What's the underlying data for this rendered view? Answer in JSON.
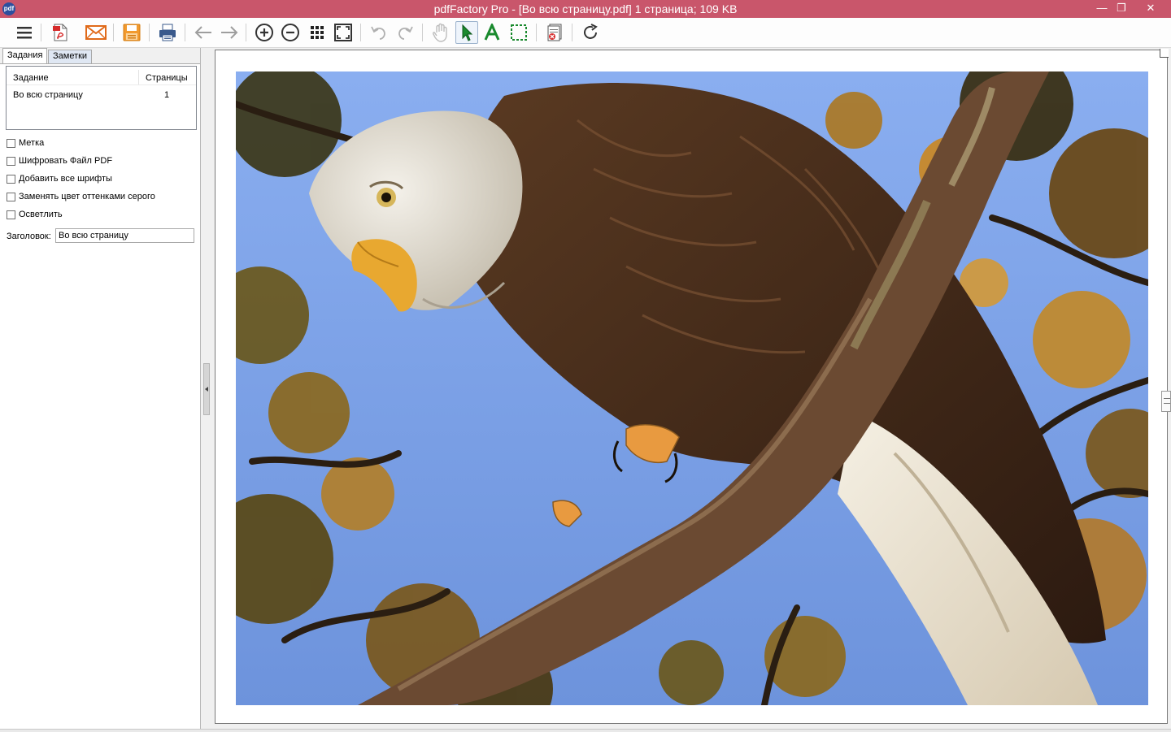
{
  "window": {
    "title": "pdfFactory Pro - [Во всю страницу.pdf] 1 страница; 109 KB",
    "app_icon_label": "pdf",
    "title_color": "#c9566b",
    "minimize_glyph": "—",
    "restore_glyph": "❐",
    "close_glyph": "✕"
  },
  "toolbar": {
    "items": [
      "menu-icon",
      "pdf-icon",
      "email-icon",
      "save-icon",
      "print-icon",
      "back-arrow-icon",
      "forward-arrow-icon",
      "zoom-in-icon",
      "zoom-out-icon",
      "thumbnails-icon",
      "fit-page-icon",
      "undo-icon",
      "redo-icon",
      "hand-tool-icon",
      "select-cursor-icon",
      "text-tool-icon",
      "selection-rect-icon",
      "delete-page-icon",
      "rotate-icon"
    ],
    "active_item": "select-cursor-icon"
  },
  "left_panel": {
    "tabs": [
      {
        "label": "Задания",
        "active": true
      },
      {
        "label": "Заметки",
        "active": false
      }
    ],
    "job_list": {
      "columns": [
        "Задание",
        "Страницы"
      ],
      "rows": [
        {
          "name": "Во всю страницу",
          "pages": "1"
        }
      ]
    },
    "options": [
      {
        "label": "Метка",
        "checked": false
      },
      {
        "label": "Шифровать Файл PDF",
        "checked": false
      },
      {
        "label": "Добавить все шрифты",
        "checked": false
      },
      {
        "label": "Заменять цвет оттенками серого",
        "checked": false
      },
      {
        "label": "Осветлить",
        "checked": false
      }
    ],
    "title_field": {
      "label": "Заголовок:",
      "value": "Во всю страницу"
    }
  },
  "preview": {
    "image_description": "bald-eagle-on-branch"
  }
}
